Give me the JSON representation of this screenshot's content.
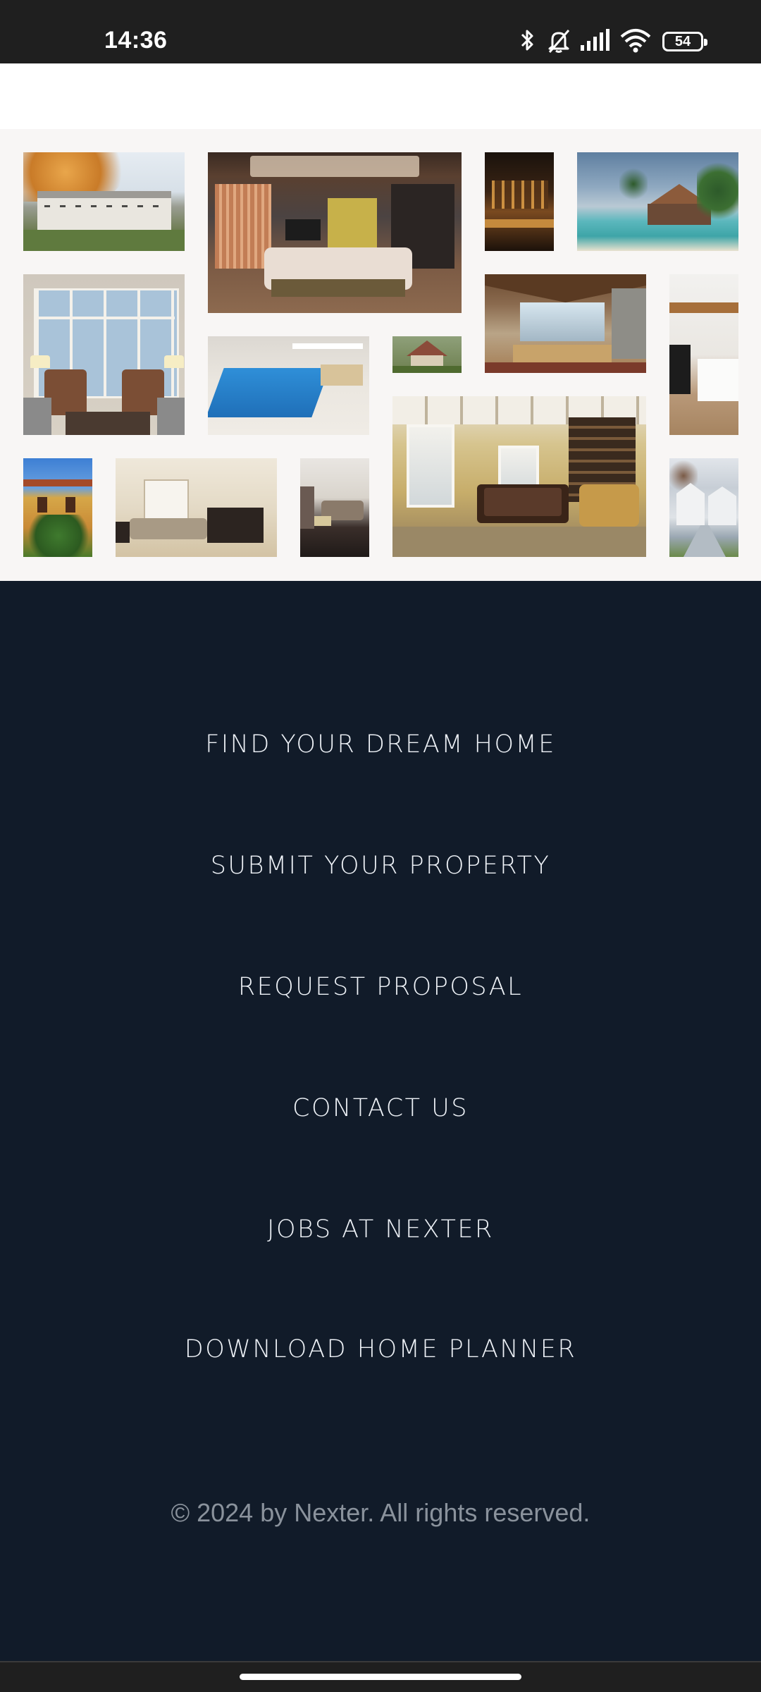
{
  "status_bar": {
    "time": "14:36",
    "battery_level": "54",
    "icons": [
      "bluetooth-icon",
      "muted-bell-icon",
      "cellular-signal-icon",
      "wifi-icon",
      "battery-icon"
    ]
  },
  "gallery": {
    "photos": [
      "colonial-house-autumn",
      "modern-living-room",
      "hotel-bar-night",
      "beach-bungalow",
      "window-living-room",
      "indoor-pool",
      "small-cottage",
      "lodge-great-room",
      "modern-kitchen",
      "mediterranean-villa",
      "bright-living-room",
      "dark-sofa-lounge",
      "billiard-room",
      "white-townhouses"
    ]
  },
  "footer_nav": {
    "links": [
      "FIND YOUR DREAM HOME",
      "SUBMIT YOUR PROPERTY",
      "REQUEST PROPOSAL",
      "CONTACT US",
      "JOBS AT NEXTER",
      "DOWNLOAD HOME PLANNER"
    ],
    "copyright": "© 2024 by Nexter. All rights reserved."
  },
  "colors": {
    "footer_background": "#111b29",
    "gallery_background": "#f8f6f5",
    "link_text": "#eef2f7",
    "copyright_text": "#8a929c",
    "system_bar": "#1f1f1f"
  }
}
